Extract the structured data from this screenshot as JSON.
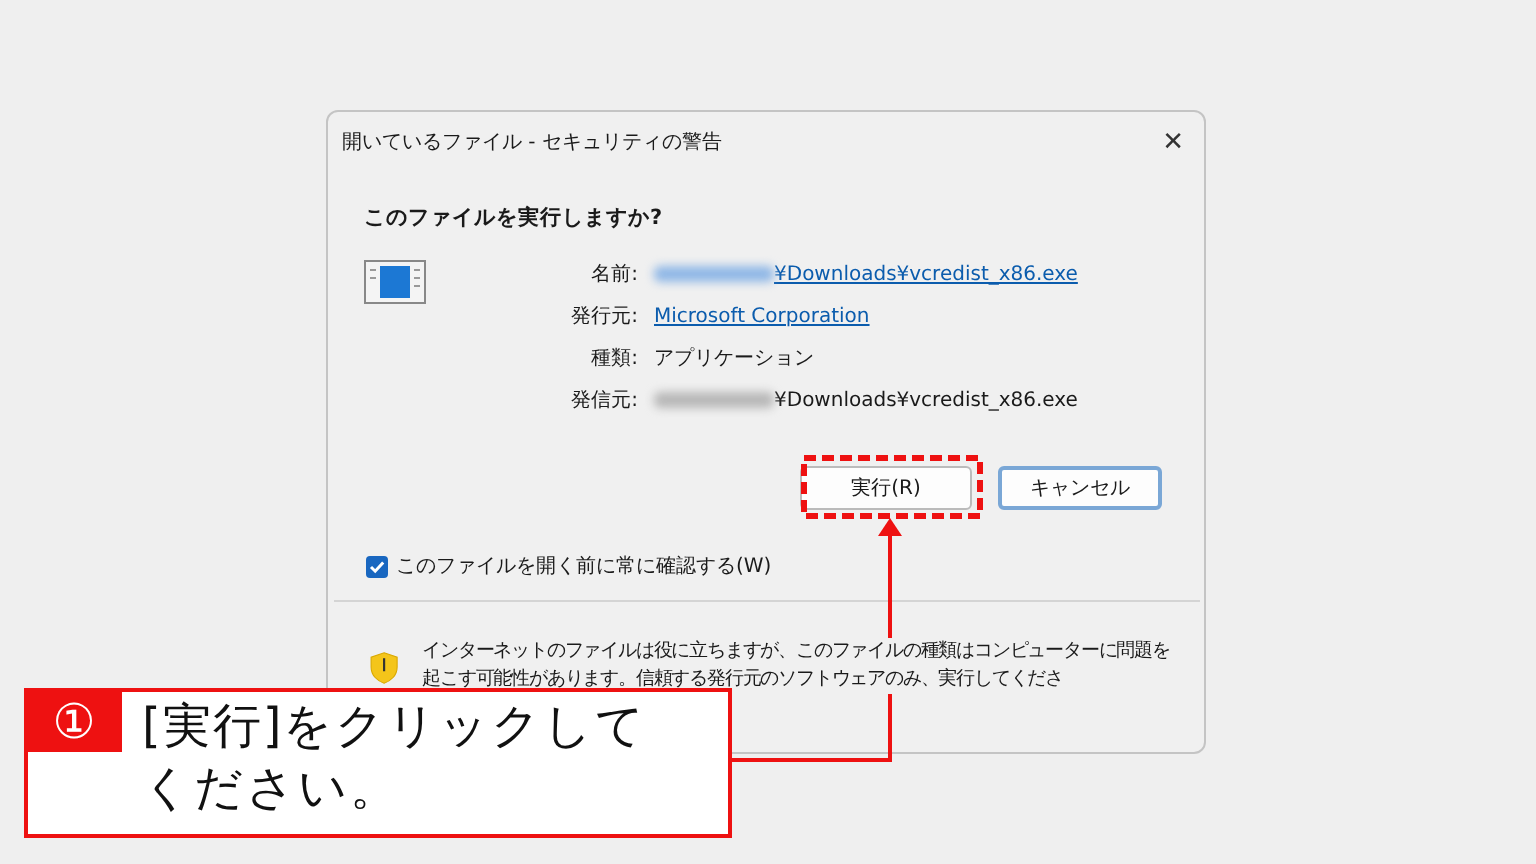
{
  "window": {
    "title": "開いているファイル - セキュリティの警告",
    "close": "✕"
  },
  "question": "このファイルを実行しますか?",
  "fields": [
    {
      "label": "名前:",
      "value": "¥Downloads¥vcredist_x86.exe",
      "kind": "link",
      "redacted": true
    },
    {
      "label": "発行元:",
      "value": "Microsoft Corporation",
      "kind": "link",
      "redacted": false
    },
    {
      "label": "種類:",
      "value": "アプリケーション",
      "kind": "text",
      "redacted": false
    },
    {
      "label": "発信元:",
      "value": "¥Downloads¥vcredist_x86.exe",
      "kind": "text",
      "redacted": true
    }
  ],
  "buttons": [
    {
      "label": "実行(R)",
      "highlighted": true
    },
    {
      "label": "キャンセル",
      "highlighted": false
    }
  ],
  "checkbox": {
    "label": "このファイルを開く前に常に確認する(W)",
    "checked": true
  },
  "warning": {
    "text": "インターネットのファイルは役に立ちますが、このファイルの種類はコンピューターに問題を起こす可能性があります。信頼する発行元のソフトウェアのみ、実行してくださ"
  },
  "callout": {
    "number": "①",
    "text": "[実行]をクリックしてください。"
  }
}
